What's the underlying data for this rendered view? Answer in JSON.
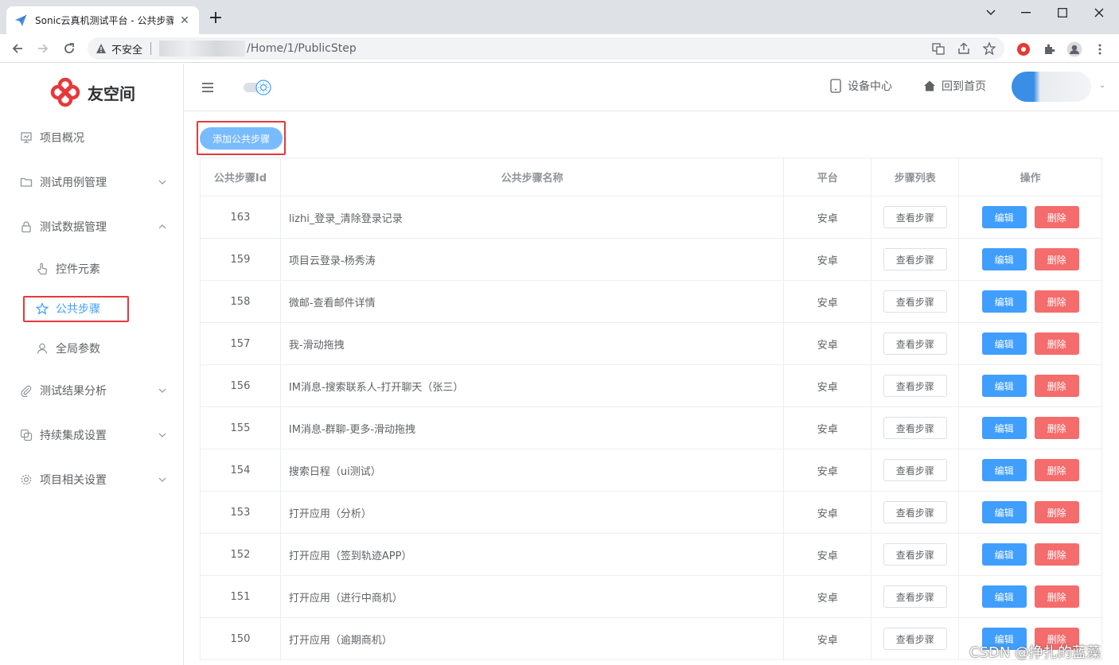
{
  "browser": {
    "tab_title": "Sonic云真机测试平台 - 公共步骤",
    "insecure_label": "不安全",
    "url_path": "/Home/1/PublicStep"
  },
  "sidebar": {
    "logo_text": "友空间",
    "items": [
      {
        "label": "项目概况",
        "icon": "presentation-icon"
      },
      {
        "label": "测试用例管理",
        "icon": "folder-icon"
      },
      {
        "label": "测试数据管理",
        "icon": "lock-icon"
      },
      {
        "label": "控件元素",
        "icon": "pointer-hand-icon"
      },
      {
        "label": "公共步骤",
        "icon": "star-icon"
      },
      {
        "label": "全局参数",
        "icon": "user-icon"
      },
      {
        "label": "测试结果分析",
        "icon": "paperclip-icon"
      },
      {
        "label": "持续集成设置",
        "icon": "copy-icon"
      },
      {
        "label": "项目相关设置",
        "icon": "gear-icon"
      }
    ]
  },
  "header": {
    "device_center": "设备中心",
    "back_home": "回到首页"
  },
  "main": {
    "add_button": "添加公共步骤",
    "columns": [
      "公共步骤Id",
      "公共步骤名称",
      "平台",
      "步骤列表",
      "操作"
    ],
    "view_label": "查看步骤",
    "edit_label": "编辑",
    "delete_label": "删除",
    "rows": [
      {
        "id": "163",
        "name": "lizhi_登录_清除登录记录",
        "platform": "安卓"
      },
      {
        "id": "159",
        "name": "项目云登录-杨秀涛",
        "platform": "安卓"
      },
      {
        "id": "158",
        "name": "微邮-查看邮件详情",
        "platform": "安卓"
      },
      {
        "id": "157",
        "name": "我-滑动拖拽",
        "platform": "安卓"
      },
      {
        "id": "156",
        "name": "IM消息-搜索联系人-打开聊天（张三）",
        "platform": "安卓"
      },
      {
        "id": "155",
        "name": "IM消息-群聊-更多-滑动拖拽",
        "platform": "安卓"
      },
      {
        "id": "154",
        "name": "搜索日程（ui测试）",
        "platform": "安卓"
      },
      {
        "id": "153",
        "name": "打开应用（分析）",
        "platform": "安卓"
      },
      {
        "id": "152",
        "name": "打开应用（签到轨迹APP）",
        "platform": "安卓"
      },
      {
        "id": "151",
        "name": "打开应用（进行中商机）",
        "platform": "安卓"
      },
      {
        "id": "150",
        "name": "打开应用（逾期商机）",
        "platform": "安卓"
      }
    ]
  },
  "watermark": "CSDN @挣扎的蓝藻",
  "colors": {
    "primary": "#409eff",
    "danger": "#f56c6c",
    "highlight": "#e4393c"
  }
}
